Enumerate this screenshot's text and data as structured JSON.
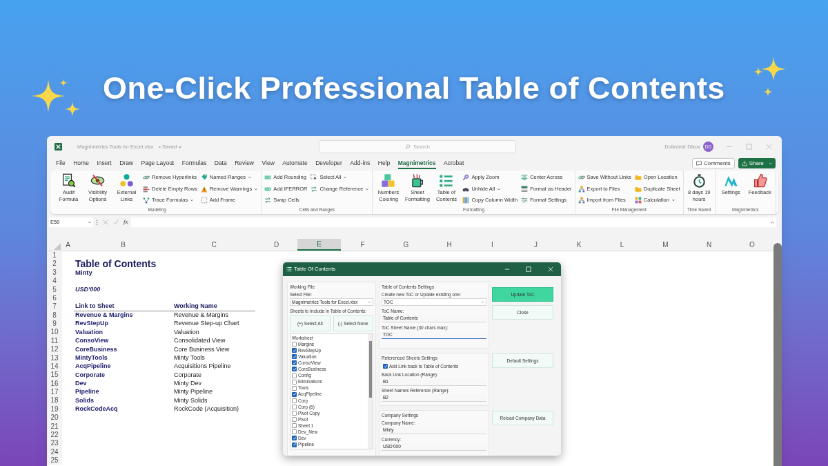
{
  "headline": "One-Click Professional Table of Contents",
  "window": {
    "file_name": "Magnimetrics Tools for Excel.xlsx",
    "save_status": "• Saved",
    "search": {
      "placeholder": "Search"
    },
    "user_name": "Dobromir Dikov",
    "user_initials": "DD"
  },
  "menu_tabs": [
    {
      "label": "File",
      "selected": false
    },
    {
      "label": "Home",
      "selected": false
    },
    {
      "label": "Insert",
      "selected": false
    },
    {
      "label": "Draw",
      "selected": false
    },
    {
      "label": "Page Layout",
      "selected": false
    },
    {
      "label": "Formulas",
      "selected": false
    },
    {
      "label": "Data",
      "selected": false
    },
    {
      "label": "Review",
      "selected": false
    },
    {
      "label": "View",
      "selected": false
    },
    {
      "label": "Automate",
      "selected": false
    },
    {
      "label": "Developer",
      "selected": false
    },
    {
      "label": "Add-ins",
      "selected": false
    },
    {
      "label": "Help",
      "selected": false
    },
    {
      "label": "Magnimetrics",
      "selected": true
    },
    {
      "label": "Acrobat",
      "selected": false
    }
  ],
  "menu_buttons": {
    "comments": "Comments",
    "share": "Share"
  },
  "ribbon_groups": [
    {
      "name": "Modeling",
      "columns": [
        {
          "kind": "large",
          "label": "Audit Formula"
        },
        {
          "kind": "large",
          "label": "Visibility Options"
        },
        {
          "kind": "large",
          "label": "External Links"
        },
        {
          "kind": "stack",
          "items": [
            {
              "label": "Remove Hyperlinks",
              "dropdown": false
            },
            {
              "label": "Delete Empty Rows",
              "dropdown": false
            },
            {
              "label": "Trace Formulas",
              "dropdown": true
            }
          ]
        },
        {
          "kind": "stack",
          "items": [
            {
              "label": "Named Ranges",
              "dropdown": true
            },
            {
              "label": "Remove Warnings",
              "dropdown": true
            },
            {
              "label": "Add Frame",
              "dropdown": false
            }
          ]
        }
      ]
    },
    {
      "name": "Cells and Ranges",
      "columns": [
        {
          "kind": "stack",
          "items": [
            {
              "label": "Add Rounding",
              "dropdown": false
            },
            {
              "label": "Add IFERROR",
              "dropdown": false
            },
            {
              "label": "Swap Cells",
              "dropdown": false
            }
          ]
        },
        {
          "kind": "stack",
          "items": [
            {
              "label": "Select All",
              "dropdown": true
            },
            {
              "label": "Change Reference",
              "dropdown": true
            }
          ]
        }
      ]
    },
    {
      "name": "Formatting",
      "columns": [
        {
          "kind": "large",
          "label": "Numbers Coloring"
        },
        {
          "kind": "large",
          "label": "Sheet Formatting"
        },
        {
          "kind": "large",
          "label": "Table of Contents"
        },
        {
          "kind": "stack",
          "items": [
            {
              "label": "Apply Zoom",
              "dropdown": false
            },
            {
              "label": "Unhide All",
              "dropdown": true
            },
            {
              "label": "Copy Column Width",
              "dropdown": false
            }
          ]
        },
        {
          "kind": "stack",
          "items": [
            {
              "label": "Center Across",
              "dropdown": false
            },
            {
              "label": "Format as Header",
              "dropdown": false
            },
            {
              "label": "Format Settings",
              "dropdown": false
            }
          ]
        }
      ]
    },
    {
      "name": "File Management",
      "columns": [
        {
          "kind": "stack",
          "items": [
            {
              "label": "Save Without Links",
              "dropdown": false
            },
            {
              "label": "Export to Files",
              "dropdown": false
            },
            {
              "label": "Import from Files",
              "dropdown": false
            }
          ]
        },
        {
          "kind": "stack",
          "items": [
            {
              "label": "Open Location",
              "dropdown": false
            },
            {
              "label": "Duplicate Sheet",
              "dropdown": false
            },
            {
              "label": "Calculation",
              "dropdown": true
            }
          ]
        }
      ]
    },
    {
      "name": "Time Saved",
      "columns": [
        {
          "kind": "large",
          "label": "8 days 19 hours"
        }
      ]
    },
    {
      "name": "Magnimetrics",
      "columns": [
        {
          "kind": "large",
          "label": "Settings"
        },
        {
          "kind": "large",
          "label": "Feedback"
        }
      ]
    }
  ],
  "formula_bar": {
    "name_box": "E50",
    "function_label": "fx"
  },
  "sheet": {
    "columns": [
      {
        "label": "A",
        "selected": false
      },
      {
        "label": "B",
        "selected": false
      },
      {
        "label": "C",
        "selected": false
      },
      {
        "label": "D",
        "selected": false
      },
      {
        "label": "E",
        "selected": true
      },
      {
        "label": "F",
        "selected": false
      },
      {
        "label": "G",
        "selected": false
      },
      {
        "label": "H",
        "selected": false
      },
      {
        "label": "I",
        "selected": false
      },
      {
        "label": "J",
        "selected": false
      },
      {
        "label": "K",
        "selected": false
      },
      {
        "label": "L",
        "selected": false
      },
      {
        "label": "M",
        "selected": false
      },
      {
        "label": "N",
        "selected": false
      },
      {
        "label": "O",
        "selected": false
      }
    ],
    "row_numbers": [
      "1",
      "2",
      "3",
      "4",
      "5",
      "6",
      "7",
      "8",
      "9",
      "10",
      "11",
      "12",
      "13",
      "14",
      "15",
      "16",
      "17",
      "18",
      "19",
      "20",
      "21",
      "22",
      "23",
      "24",
      "25"
    ],
    "title": "Table of Contents",
    "company": "Minty",
    "currency": "USD'000",
    "table": {
      "columns": [
        "Link to Sheet",
        "Working Name"
      ],
      "rows": [
        [
          "Revenue & Margins",
          "Revenue & Margins"
        ],
        [
          "RevStepUp",
          "Revenue Step-up Chart"
        ],
        [
          "Valuation",
          "Valuation"
        ],
        [
          "ConsoView",
          "Consolidated View"
        ],
        [
          "CoreBusiness",
          "Core Business View"
        ],
        [
          "MintyTools",
          "Minty Tools"
        ],
        [
          "AcqPipeline",
          "Acquisitions Pipeline"
        ],
        [
          "Corporate",
          "Corporate"
        ],
        [
          "Dev",
          "Minty Dev"
        ],
        [
          "Pipeline",
          "Minty Pipeline"
        ],
        [
          "Solids",
          "Minty Solids"
        ],
        [
          "RockCodeAcq",
          "RockCode (Acquisition)"
        ]
      ]
    }
  },
  "dialog": {
    "title": "Table Of Contents",
    "working_file": {
      "heading": "Working File",
      "select_label": "Select File:",
      "file": "Magnimetrics Tools for Excel.xlsx",
      "sheets_label": "Sheets to Include in Table of Contents:",
      "select_all": "(+) Select All",
      "select_none": "(-) Select None",
      "list_header": "Worksheet",
      "sheets": [
        {
          "name": "Margins",
          "checked": false
        },
        {
          "name": "RevStepUp",
          "checked": true
        },
        {
          "name": "Valuation",
          "checked": true
        },
        {
          "name": "ConsoView",
          "checked": true
        },
        {
          "name": "CoreBusiness",
          "checked": true
        },
        {
          "name": "Config",
          "checked": false
        },
        {
          "name": "Eliminations",
          "checked": false
        },
        {
          "name": "Tools",
          "checked": false
        },
        {
          "name": "AcqPipeline",
          "checked": true
        },
        {
          "name": "Corp",
          "checked": false
        },
        {
          "name": "Corp (6)",
          "checked": false
        },
        {
          "name": "Pivot Copy",
          "checked": false
        },
        {
          "name": "Pivot",
          "checked": false
        },
        {
          "name": "Sheet 1",
          "checked": false
        },
        {
          "name": "Dev_New",
          "checked": false
        },
        {
          "name": "Dev",
          "checked": true
        },
        {
          "name": "Pipeline",
          "checked": true
        }
      ]
    },
    "toc_settings": {
      "heading": "Table of Contents Settings",
      "mode_label": "Create new ToC or Update existing one:",
      "mode": "TOC",
      "name_label": "ToC Name:",
      "name": "Table of Contents",
      "sheet_name_label": "ToC Sheet Name (30 chars max):",
      "sheet_name": "TOC",
      "sheet_name_focused": true
    },
    "referenced": {
      "heading": "Referenced Sheets Settings",
      "add_link_label": "Add Link back to Table of Contents",
      "add_link": true,
      "back_link_label": "Back Link Location (Range):",
      "back_link": "B1",
      "names_ref_label": "Sheet Names Reference (Range):",
      "names_ref": "B2"
    },
    "company": {
      "heading": "Company Settings",
      "name_label": "Company Name:",
      "name": "Minty",
      "currency_label": "Currency:",
      "currency": "USD'000"
    },
    "buttons": [
      {
        "label": "Update ToC",
        "kind": "primary"
      },
      {
        "label": "Close",
        "kind": "secondary"
      },
      {
        "label": "Default Settings",
        "kind": "secondary"
      },
      {
        "label": "Reload Company Data",
        "kind": "secondary"
      }
    ]
  }
}
